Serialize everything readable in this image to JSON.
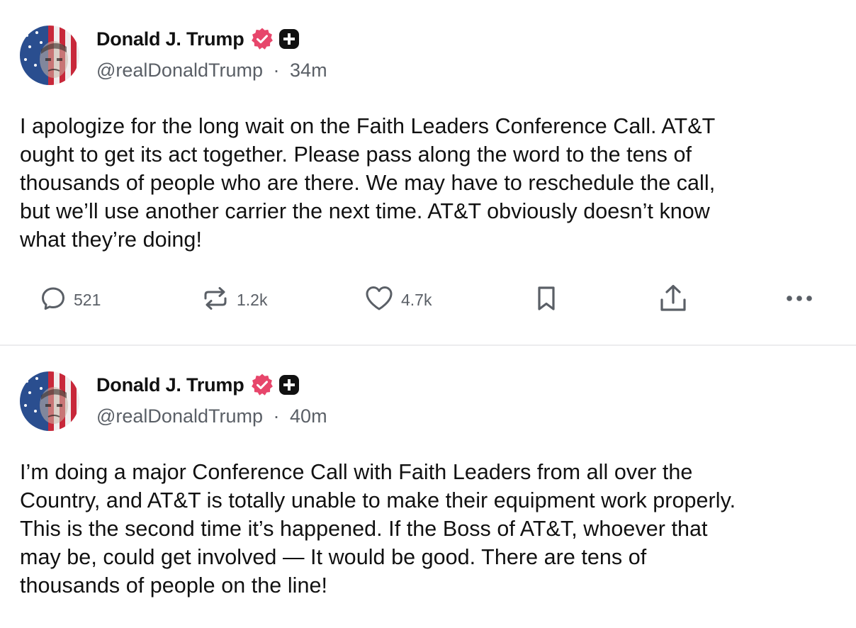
{
  "posts": [
    {
      "author": {
        "display_name": "Donald J. Trump",
        "handle": "@realDonaldTrump",
        "time_ago": "34m"
      },
      "text_lines": [
        "I apologize for the long wait on the Faith Leaders Conference Call. AT&T",
        "ought to get its act together. Please pass along the word to the tens of",
        "thousands of people who are there. We may have to reschedule the call,",
        "but we’ll use another carrier the next time. AT&T obviously doesn’t know",
        "what they’re doing!"
      ],
      "actions": {
        "replies": "521",
        "reposts": "1.2k",
        "likes": "4.7k"
      }
    },
    {
      "author": {
        "display_name": "Donald J. Trump",
        "handle": "@realDonaldTrump",
        "time_ago": "40m"
      },
      "text_lines": [
        "I’m doing a major Conference Call with Faith Leaders from all over the",
        "Country, and AT&T is totally unable to make their equipment work properly.",
        "This is the second time it’s happened. If the Boss of AT&T, whoever that",
        "may be, could get involved — It would be good. There are tens of",
        "thousands of people on the line!"
      ]
    }
  ],
  "separator": "·",
  "icons": {
    "reply": "speech-bubble-icon",
    "repost": "repost-arrows-icon",
    "like": "heart-icon",
    "bookmark": "bookmark-icon",
    "share": "share-upload-icon",
    "more": "ellipsis-icon",
    "verified": "verified-badge-icon",
    "plus": "plus-badge-icon"
  },
  "colors": {
    "verified_badge": "#e7466b",
    "plus_badge": "#111111",
    "text": "#111111",
    "meta_text": "#5a5f66",
    "divider": "#ececee"
  }
}
